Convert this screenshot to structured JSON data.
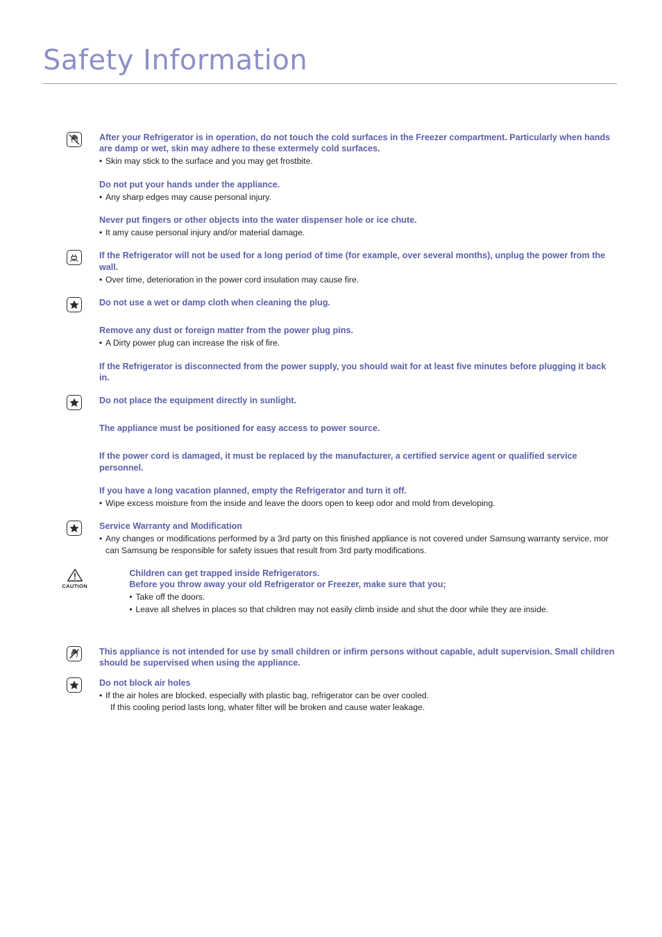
{
  "page": {
    "title": "Safety Information"
  },
  "blocks": [
    {
      "icon": "no-touch-cold-surface-icon",
      "headings": [
        "After your Refrigerator is in operation, do not touch the cold surfaces in the Freezer compartment. Particularly when hands are damp or wet, skin may adhere to these extermely cold surfaces."
      ],
      "bullets": [
        "Skin may stick to the surface and you may get frostbite."
      ]
    },
    {
      "icon": "none",
      "headings": [
        "Do not put your hands under the appliance."
      ],
      "bullets": [
        "Any sharp edges may cause personal injury."
      ]
    },
    {
      "icon": "none",
      "headings": [
        "Never put fingers or other objects into the water dispenser hole or ice chute."
      ],
      "bullets": [
        "It amy cause personal injury and/or material damage."
      ]
    },
    {
      "icon": "unplug-power-icon",
      "headings": [
        "If the Refrigerator will not be used for a long period of time (for example, over several months), unplug the power from the wall."
      ],
      "bullets": [
        "Over time, deterioration in the power cord insulation may cause fire."
      ]
    },
    {
      "icon": "star-icon",
      "headings": [
        "Do not use a wet or damp cloth when cleaning the plug."
      ],
      "bullets": []
    },
    {
      "icon": "none",
      "headings": [
        "Remove any dust or foreign matter from the power plug pins."
      ],
      "bullets": [
        "A Dirty power plug can increase the risk of fire."
      ]
    },
    {
      "icon": "none",
      "headings": [
        "If the Refrigerator is disconnected from the power supply, you should wait for at least five minutes before plugging it back in."
      ],
      "bullets": []
    },
    {
      "icon": "star-icon",
      "headings": [
        "Do not place the equipment directly in sunlight."
      ],
      "bullets": []
    },
    {
      "icon": "none",
      "headings": [
        "The appliance must be positioned for easy access to power source."
      ],
      "bullets": []
    },
    {
      "icon": "none",
      "headings": [
        "If the power cord is damaged, it must be replaced by the manufacturer, a certified service agent or qualified service personnel."
      ],
      "bullets": []
    },
    {
      "icon": "none",
      "headings": [
        "If you have a long vacation planned, empty the Refrigerator and turn it off."
      ],
      "bullets": [
        "Wipe excess moisture from the inside and leave the doors open to keep odor and mold from developing."
      ]
    },
    {
      "icon": "star-icon",
      "headings": [
        "Service Warranty and Modification"
      ],
      "bullets": [
        "Any changes or modifications performed by a 3rd party on this finished appliance is not covered under Samsung warranty service, mor can Samsung be responsible for safety issues that result from 3rd party modifications."
      ]
    },
    {
      "icon": "caution-icon",
      "icon_label": "CAUTION",
      "headings": [
        "Children can get trapped inside Refrigerators.",
        "Before you throw away your old Refrigerator or Freezer, make sure that you;"
      ],
      "bullets": [
        "Take off the doors.",
        "Leave all shelves in places so that children may not easily climb inside and shut the door while they are inside."
      ]
    },
    {
      "icon": "no-hand-icon",
      "headings": [
        "This appliance is not intended for use by small children or infirm persons without capable, adult supervision. Small children should be supervised when using the appliance."
      ],
      "bullets": []
    },
    {
      "icon": "star-icon",
      "headings": [
        "Do not block air holes"
      ],
      "bullets": [
        "If the air holes are blocked, especially with plastic bag, refrigerator can be over cooled."
      ],
      "bullet_continuations": [
        "If this cooling period lasts long, whater filter will be broken and cause water leakage."
      ]
    }
  ],
  "colors": {
    "heading": "#5b5fa8",
    "title": "#8c8fc8",
    "body": "#231f20"
  }
}
